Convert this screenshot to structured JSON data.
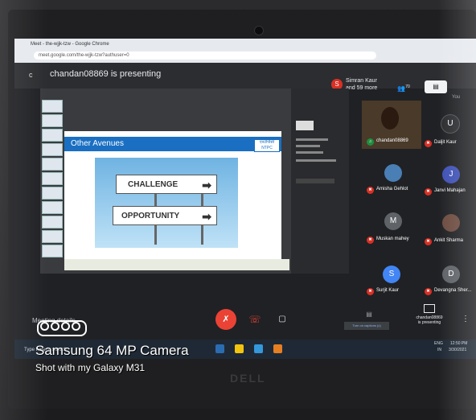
{
  "browser": {
    "tab_title": "Meet - the-wjjk-tzw - Google Chrome",
    "url": "meet.google.com/the-wjjk-tzw?authuser=0"
  },
  "meet_header": {
    "letter": "c",
    "presenting_text": "chandan08869 is presenting",
    "avatar_letter": "S",
    "participants_line1": "Simran Kaur",
    "participants_line2": "and 59 more",
    "people_count": "70",
    "you_label": "You"
  },
  "slide": {
    "title": "Other Avenues",
    "sign_top": "CHALLENGE",
    "sign_bottom": "OPPORTUNITY",
    "logo_text": "एनटीपीसी NTPC"
  },
  "participants": [
    {
      "name": "chandan08869",
      "letter": ""
    },
    {
      "name": "Daljit Kaur",
      "letter": "U"
    },
    {
      "name": "Amisha Gehlot",
      "letter": ""
    },
    {
      "name": "Janvi Mahajan",
      "letter": "J"
    },
    {
      "name": "Muskan mahey",
      "letter": "M"
    },
    {
      "name": "Ankit Sharma",
      "letter": ""
    },
    {
      "name": "Surjit Kaur",
      "letter": "S"
    },
    {
      "name": "Devangna Sher...",
      "letter": "D"
    }
  ],
  "controls": {
    "meeting_details": "Meeting details",
    "captions": "Turn on captions (c)",
    "presenting_label": "chandan08869",
    "presenting_sub": "is presenting"
  },
  "taskbar": {
    "search_placeholder": "Type here to search",
    "lang": "ENG",
    "lang_sub": "IN",
    "time": "12:50 PM",
    "date": "3/30/2021"
  },
  "watermark": {
    "line1": "Samsung 64 MP Camera",
    "line2": "Shot with my Galaxy M31"
  },
  "brand": "DELL",
  "colors": {
    "accent_red": "#d93025",
    "meet_bg": "#202124",
    "slide_blue": "#1a6fc2"
  }
}
